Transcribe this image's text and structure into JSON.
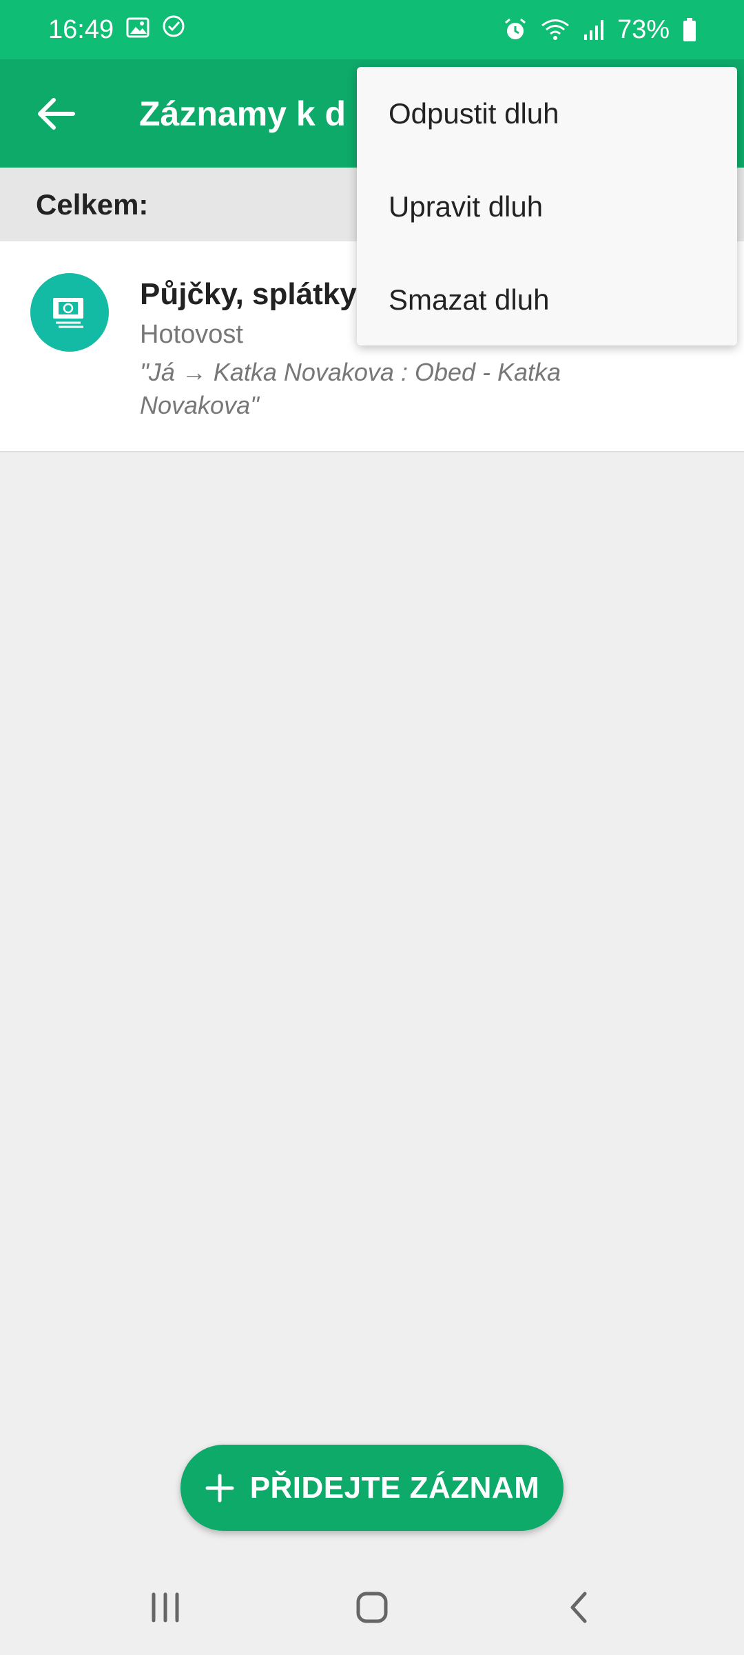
{
  "status_bar": {
    "time": "16:49",
    "battery": "73%",
    "icons": [
      "gallery-icon",
      "check-circle-icon",
      "alarm-icon",
      "wifi-icon",
      "signal-icon",
      "battery-icon"
    ]
  },
  "app_bar": {
    "title": "Záznamy k d",
    "back_icon": "back-arrow-icon"
  },
  "summary": {
    "label": "Celkem:"
  },
  "records": [
    {
      "title": "Půjčky, splátky",
      "account": "Hotovost",
      "note": "\"Já → Katka Novakova : Obed - Katka Novakova\"",
      "icon": "money-icon"
    }
  ],
  "menu": {
    "items": [
      {
        "label": "Odpustit dluh"
      },
      {
        "label": "Upravit dluh"
      },
      {
        "label": "Smazat dluh"
      }
    ]
  },
  "fab": {
    "label": "PŘIDEJTE ZÁZNAM",
    "icon": "plus-icon"
  },
  "colors": {
    "status_bar": "#10bd74",
    "app_bar": "#0eaa6a",
    "avatar": "#14bba4",
    "background": "#efefef"
  },
  "nav": {
    "icons": [
      "recent-apps-icon",
      "home-icon",
      "back-icon"
    ]
  }
}
